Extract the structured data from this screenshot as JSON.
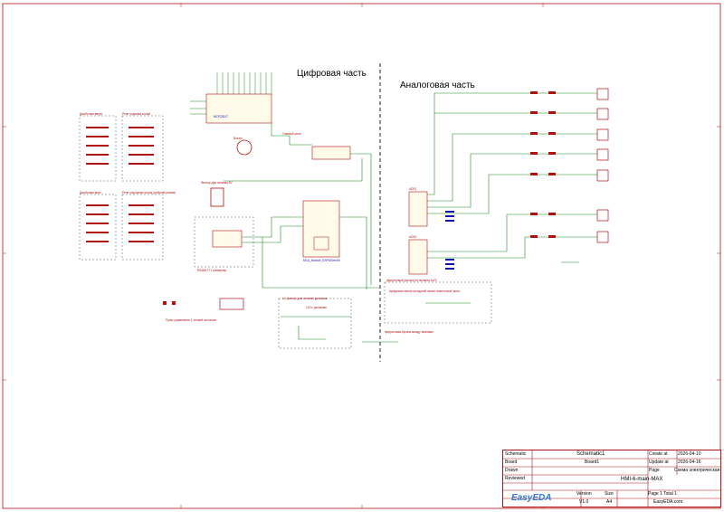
{
  "sections": {
    "digital": "Цифровая часть",
    "analog": "Аналоговая часть"
  },
  "blocks": {
    "buttons_up": "Джойстики вверх",
    "relay_up": "Реле подъема штока",
    "buttons_down": "Джойстики вниз",
    "relay_down": "Реле опускания штока (рабочий режим)",
    "buzzer": "Buzzer",
    "service": "Главный реле",
    "rs485": "RS485-TTL конвертер",
    "power_filter": "Фильтр для питания 5V",
    "cap_filter": "LC фильтр для питания датчиков",
    "sensors": "12V к датчикам",
    "pins_note": "Пульт управления 1 линией на кнопке",
    "divider_note": "Цифровая земля на единой земле аналоговой части",
    "ferrite": "ферритовая бусина между землями",
    "mcu": "MCU_Module_ESP32DevKit",
    "ads1": "ADS1",
    "ads2": "ADS2",
    "mcp": "MCP23017",
    "ferrite_gnd": "ферритовый фильтр на питании 4x2T"
  },
  "title_block": {
    "schematic_label": "Schematic",
    "schematic_value": "Schematic1",
    "create_label": "Create at",
    "create_value": "2026-04-10",
    "update_label": "Update at",
    "update_value": "2026-04-16",
    "board_label": "Board",
    "board_value": "Board1",
    "page_label": "Page",
    "page_value": "Схема электрическая",
    "drawn_label": "Drawn",
    "reviewed_label": "Reviewed",
    "name_value": "HMI-6-main-MAX",
    "version_label": "Version",
    "size_label": "Size",
    "version_value": "V1.0",
    "size_value": "A4",
    "page_count": "Page  1  Total  1",
    "site": "EasyEDA.com",
    "logo": "EasyEDA"
  },
  "colors": {
    "frame": "#b01010",
    "wire": "#1c8c1c",
    "part": "#b01010",
    "dash": "#444444"
  }
}
